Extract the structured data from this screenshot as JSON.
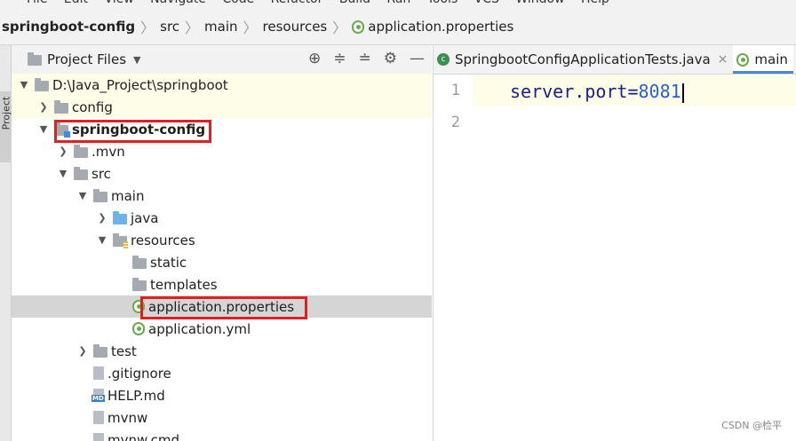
{
  "menubar": {
    "items": [
      "File",
      "Edit",
      "View",
      "Navigate",
      "Code",
      "Refactor",
      "Build",
      "Run",
      "Tools",
      "VCS",
      "Window",
      "Help"
    ]
  },
  "breadcrumb": [
    "springboot-config",
    "src",
    "main",
    "resources",
    "application.properties"
  ],
  "toolstrip": {
    "label": "Project"
  },
  "project_panel": {
    "title": "Project Files",
    "rows": [
      {
        "label": "D:\\Java_Project\\springboot",
        "depth": 0,
        "expanded": true,
        "icon": "folder"
      },
      {
        "label": "config",
        "depth": 1,
        "expanded": false,
        "icon": "folder"
      },
      {
        "label": "springboot-config",
        "depth": 1,
        "expanded": true,
        "icon": "module-folder"
      },
      {
        "label": ".mvn",
        "depth": 2,
        "expanded": false,
        "icon": "folder"
      },
      {
        "label": "src",
        "depth": 2,
        "expanded": true,
        "icon": "folder"
      },
      {
        "label": "main",
        "depth": 3,
        "expanded": true,
        "icon": "folder"
      },
      {
        "label": "java",
        "depth": 4,
        "expanded": false,
        "icon": "source-folder"
      },
      {
        "label": "resources",
        "depth": 4,
        "expanded": true,
        "icon": "resources-folder"
      },
      {
        "label": "static",
        "depth": 5,
        "icon": "folder"
      },
      {
        "label": "templates",
        "depth": 5,
        "icon": "folder"
      },
      {
        "label": "application.properties",
        "depth": 5,
        "icon": "spring-leaf",
        "selected": true
      },
      {
        "label": "application.yml",
        "depth": 5,
        "icon": "spring-leaf"
      },
      {
        "label": "test",
        "depth": 3,
        "expanded": false,
        "icon": "folder"
      },
      {
        "label": ".gitignore",
        "depth": 3,
        "icon": "file"
      },
      {
        "label": "HELP.md",
        "depth": 3,
        "icon": "markdown-file"
      },
      {
        "label": "mvnw",
        "depth": 3,
        "icon": "file"
      },
      {
        "label": "mvnw.cmd",
        "depth": 3,
        "icon": "file"
      }
    ]
  },
  "editor": {
    "tabs": [
      {
        "label": "SpringbootConfigApplicationTests.java",
        "active": false,
        "icon": "java-class-icon"
      },
      {
        "label": "main",
        "active": true,
        "icon": "spring-leaf"
      }
    ],
    "lines": [
      {
        "number": "1",
        "key": "server.port",
        "eq": "=",
        "value": "8081"
      },
      {
        "number": "2",
        "key": "",
        "eq": "",
        "value": ""
      }
    ]
  },
  "watermark": "CSDN @检平",
  "colors": {
    "annotation": "#e02020",
    "accent": "#4a88d4",
    "code_key": "#1c1c8c",
    "code_value": "#2a5fd0"
  }
}
